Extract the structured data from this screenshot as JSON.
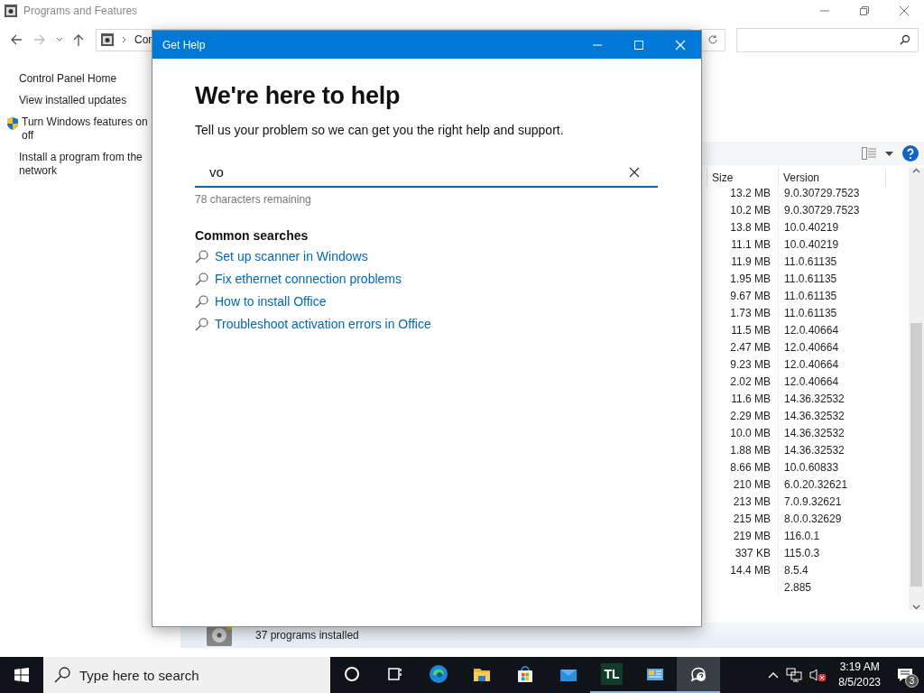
{
  "background_window": {
    "title": "Programs and Features",
    "breadcrumb": "Con",
    "sidebar": {
      "items": [
        {
          "lines": [
            "Control Panel Home"
          ],
          "shield": false
        },
        {
          "lines": [
            "View installed updates"
          ],
          "shield": false
        },
        {
          "lines": [
            "Turn Windows features on",
            "off"
          ],
          "shield": true
        },
        {
          "lines": [
            "Install a program from the",
            "network"
          ],
          "shield": false
        }
      ]
    },
    "table": {
      "columns": [
        {
          "label": "Size"
        },
        {
          "label": "Version"
        }
      ],
      "rows": [
        {
          "size": "13.2 MB",
          "version": "9.0.30729.7523"
        },
        {
          "size": "10.2 MB",
          "version": "9.0.30729.7523"
        },
        {
          "size": "13.8 MB",
          "version": "10.0.40219"
        },
        {
          "size": "11.1 MB",
          "version": "10.0.40219"
        },
        {
          "size": "11.9 MB",
          "version": "11.0.61135"
        },
        {
          "size": "1.95 MB",
          "version": "11.0.61135"
        },
        {
          "size": "9.67 MB",
          "version": "11.0.61135"
        },
        {
          "size": "1.73 MB",
          "version": "11.0.61135"
        },
        {
          "size": "11.5 MB",
          "version": "12.0.40664"
        },
        {
          "size": "2.47 MB",
          "version": "12.0.40664"
        },
        {
          "size": "9.23 MB",
          "version": "12.0.40664"
        },
        {
          "size": "2.02 MB",
          "version": "12.0.40664"
        },
        {
          "size": "11.6 MB",
          "version": "14.36.32532"
        },
        {
          "size": "2.29 MB",
          "version": "14.36.32532"
        },
        {
          "size": "10.0 MB",
          "version": "14.36.32532"
        },
        {
          "size": "1.88 MB",
          "version": "14.36.32532"
        },
        {
          "size": "8.66 MB",
          "version": "10.0.60833"
        },
        {
          "size": "210 MB",
          "version": "6.0.20.32621"
        },
        {
          "size": "213 MB",
          "version": "7.0.9.32621"
        },
        {
          "size": "215 MB",
          "version": "8.0.0.32629"
        },
        {
          "size": "219 MB",
          "version": "116.0.1"
        },
        {
          "size": "337 KB",
          "version": "115.0.3"
        },
        {
          "size": "14.4 MB",
          "version": "8.5.4"
        },
        {
          "version": "2.885"
        }
      ]
    },
    "status_bar": "37 programs installed"
  },
  "dialog": {
    "title": "Get Help",
    "heading": "We're here to help",
    "subtitle": "Tell us your problem so we can get you the right help and support.",
    "search": {
      "value": "vo"
    },
    "hint": "78 characters remaining",
    "section_title": "Common searches",
    "suggestions": [
      "Set up scanner in Windows",
      "Fix ethernet connection problems",
      "How to install Office",
      "Troubleshoot activation errors in Office"
    ]
  },
  "taskbar": {
    "search": {
      "placeholder": "Type here to search"
    },
    "apps": [
      {
        "kind": "cortana",
        "running": false,
        "selected": false
      },
      {
        "kind": "taskview",
        "running": false,
        "selected": false
      },
      {
        "kind": "edge",
        "running": false,
        "selected": false
      },
      {
        "kind": "explorer",
        "running": false,
        "selected": false
      },
      {
        "kind": "store",
        "running": false,
        "selected": false
      },
      {
        "kind": "mail",
        "running": false,
        "selected": false
      },
      {
        "kind": "tl",
        "label": "TL",
        "running": true,
        "selected": false
      },
      {
        "kind": "controlpanel",
        "running": true,
        "selected": false
      },
      {
        "kind": "help",
        "running": true,
        "selected": true
      }
    ],
    "time": "3:19 AM",
    "date": "8/5/2023",
    "notifications": "3"
  }
}
